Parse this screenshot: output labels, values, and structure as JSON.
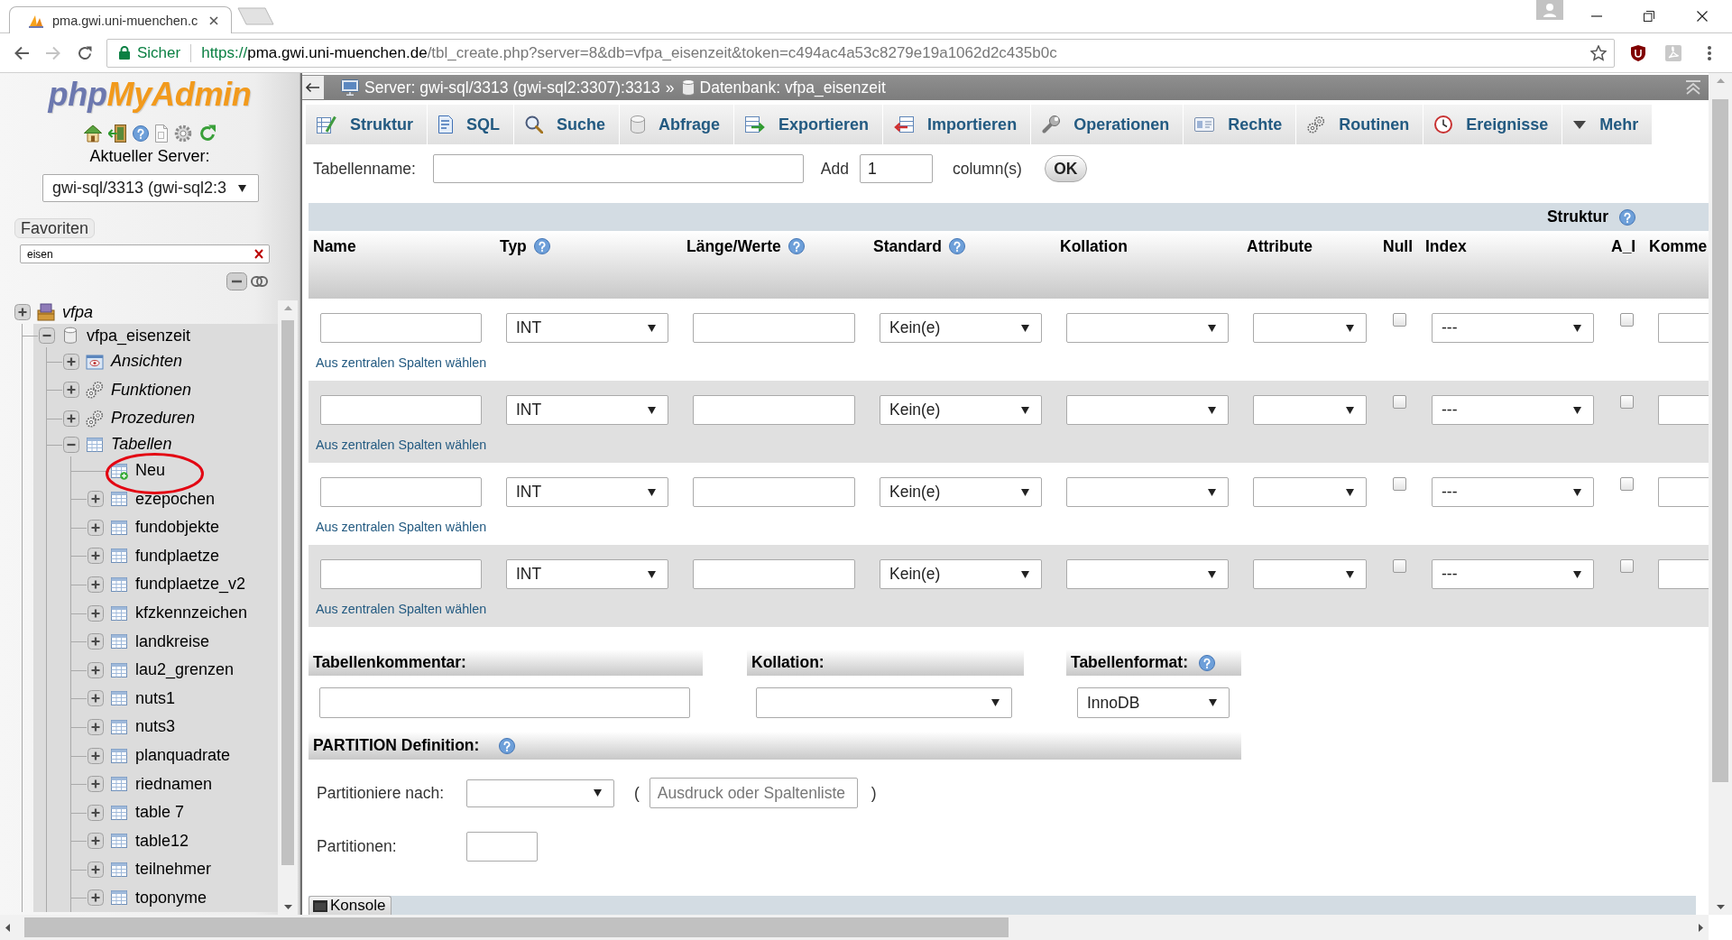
{
  "browser": {
    "tab": {
      "title": "pma.gwi.uni-muenchen.c"
    },
    "address": {
      "security": "Sicher",
      "scheme": "https://",
      "host": "pma.gwi.uni-muenchen.de",
      "path": "/tbl_create.php?server=8&db=vfpa_eisenzeit&token=c494ac4a53c8279e19a1062d2c435b0c"
    }
  },
  "sidebar": {
    "logo": {
      "prefix": "php",
      "name": "MyAdmin"
    },
    "server_label": "Aktueller Server:",
    "server_select": "gwi-sql/3313 (gwi-sql2:3",
    "favorites": "Favoriten",
    "filter": {
      "value": "eisen"
    },
    "tree": [
      {
        "label": "vfpa",
        "kind": "group",
        "expanded": false,
        "children": [
          {
            "label": "vfpa_eisenzeit",
            "kind": "database",
            "expanded": true,
            "children": [
              {
                "label": "Ansichten",
                "kind": "views",
                "expanded": false
              },
              {
                "label": "Funktionen",
                "kind": "functions",
                "expanded": false
              },
              {
                "label": "Prozeduren",
                "kind": "procedures",
                "expanded": false
              },
              {
                "label": "Tabellen",
                "kind": "tables",
                "expanded": true,
                "children": [
                  {
                    "label": "Neu",
                    "kind": "new",
                    "circled": true
                  },
                  {
                    "label": "ezepochen",
                    "kind": "table",
                    "expanded": false,
                    "circled": false
                  },
                  {
                    "label": "fundobjekte",
                    "kind": "table",
                    "expanded": false,
                    "circled": false
                  },
                  {
                    "label": "fundplaetze",
                    "kind": "table",
                    "expanded": false,
                    "circled": false
                  },
                  {
                    "label": "fundplaetze_v2",
                    "kind": "table",
                    "expanded": false,
                    "circled": false
                  },
                  {
                    "label": "kfzkennzeichen",
                    "kind": "table",
                    "expanded": false,
                    "circled": false
                  },
                  {
                    "label": "landkreise",
                    "kind": "table",
                    "expanded": false,
                    "circled": false
                  },
                  {
                    "label": "lau2_grenzen",
                    "kind": "table",
                    "expanded": false,
                    "circled": false
                  },
                  {
                    "label": "nuts1",
                    "kind": "table",
                    "expanded": false,
                    "circled": false
                  },
                  {
                    "label": "nuts3",
                    "kind": "table",
                    "expanded": false,
                    "circled": false
                  },
                  {
                    "label": "planquadrate",
                    "kind": "table",
                    "expanded": false,
                    "circled": false
                  },
                  {
                    "label": "riednamen",
                    "kind": "table",
                    "expanded": false,
                    "circled": false
                  },
                  {
                    "label": "table 7",
                    "kind": "table",
                    "expanded": false,
                    "circled": false
                  },
                  {
                    "label": "table12",
                    "kind": "table",
                    "expanded": false,
                    "circled": false
                  },
                  {
                    "label": "teilnehmer",
                    "kind": "table",
                    "expanded": false,
                    "circled": false
                  },
                  {
                    "label": "toponyme",
                    "kind": "table",
                    "expanded": false,
                    "circled": false
                  }
                ]
              }
            ]
          }
        ]
      }
    ]
  },
  "breadcrumb": {
    "server": "Server: gwi-sql/3313 (gwi-sql2:3307):3313",
    "separator": "»",
    "database": "Datenbank: vfpa_eisenzeit"
  },
  "tabs": [
    {
      "label": "Struktur",
      "kind": "structure",
      "selected": false
    },
    {
      "label": "SQL",
      "kind": "sql",
      "selected": false
    },
    {
      "label": "Suche",
      "kind": "search",
      "selected": false
    },
    {
      "label": "Abfrage",
      "kind": "query",
      "selected": false
    },
    {
      "label": "Exportieren",
      "kind": "export",
      "selected": false
    },
    {
      "label": "Importieren",
      "kind": "import",
      "selected": false
    },
    {
      "label": "Operationen",
      "kind": "operations",
      "selected": false
    },
    {
      "label": "Rechte",
      "kind": "privileges",
      "selected": false
    },
    {
      "label": "Routinen",
      "kind": "routines",
      "selected": false
    },
    {
      "label": "Ereignisse",
      "kind": "events",
      "selected": false
    },
    {
      "label": "Mehr",
      "kind": "more",
      "selected": false
    }
  ],
  "create_form": {
    "table_name_label": "Tabellenname:",
    "add_label": "Add",
    "add_count": "1",
    "columns_label": "column(s)",
    "ok_button": "OK"
  },
  "columns_table": {
    "group_header": {
      "label": "Struktur",
      "help": true
    },
    "columns": [
      {
        "label": "Name",
        "help": false
      },
      {
        "label": "Typ",
        "help": true
      },
      {
        "label": "Länge/Werte",
        "help": true
      },
      {
        "label": "Standard",
        "help": true
      },
      {
        "label": "Kollation",
        "help": false
      },
      {
        "label": "Attribute",
        "help": false
      },
      {
        "label": "Null",
        "help": false
      },
      {
        "label": "Index",
        "help": false
      },
      {
        "label": "A_I",
        "help": false
      },
      {
        "label": "Komme",
        "help": false
      }
    ],
    "rows": [
      {
        "type": "INT",
        "default": "Kein(e)",
        "index": "---",
        "null": false,
        "auto_increment": false,
        "central_link": "Aus zentralen Spalten wählen"
      },
      {
        "type": "INT",
        "default": "Kein(e)",
        "index": "---",
        "null": false,
        "auto_increment": false,
        "central_link": "Aus zentralen Spalten wählen"
      },
      {
        "type": "INT",
        "default": "Kein(e)",
        "index": "---",
        "null": false,
        "auto_increment": false,
        "central_link": "Aus zentralen Spalten wählen"
      },
      {
        "type": "INT",
        "default": "Kein(e)",
        "index": "---",
        "null": false,
        "auto_increment": false,
        "central_link": "Aus zentralen Spalten wählen"
      }
    ]
  },
  "table_options": [
    {
      "label": "Tabellenkommentar:",
      "help": false,
      "kind": "input"
    },
    {
      "label": "Kollation:",
      "help": false,
      "kind": "select"
    },
    {
      "label": "Tabellenformat:",
      "help": true,
      "kind": "select",
      "value": "InnoDB"
    }
  ],
  "partition": {
    "title": "PARTITION Definition:",
    "help": true,
    "by_label": "Partitioniere nach:",
    "open_paren": "(",
    "expression_placeholder": "Ausdruck oder Spaltenliste",
    "close_paren": ")",
    "count_label": "Partitionen:"
  },
  "console": {
    "label": "Konsole"
  }
}
